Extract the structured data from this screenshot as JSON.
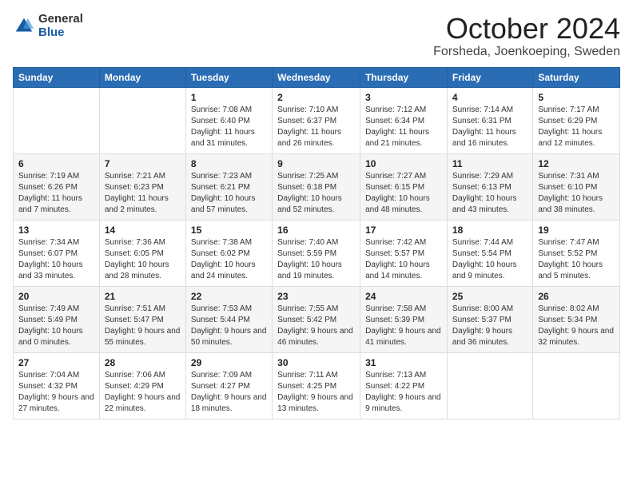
{
  "header": {
    "logo_general": "General",
    "logo_blue": "Blue",
    "title": "October 2024",
    "location": "Forsheda, Joenkoeping, Sweden"
  },
  "days_of_week": [
    "Sunday",
    "Monday",
    "Tuesday",
    "Wednesday",
    "Thursday",
    "Friday",
    "Saturday"
  ],
  "weeks": [
    [
      {
        "num": "",
        "info": ""
      },
      {
        "num": "",
        "info": ""
      },
      {
        "num": "1",
        "info": "Sunrise: 7:08 AM\nSunset: 6:40 PM\nDaylight: 11 hours and 31 minutes."
      },
      {
        "num": "2",
        "info": "Sunrise: 7:10 AM\nSunset: 6:37 PM\nDaylight: 11 hours and 26 minutes."
      },
      {
        "num": "3",
        "info": "Sunrise: 7:12 AM\nSunset: 6:34 PM\nDaylight: 11 hours and 21 minutes."
      },
      {
        "num": "4",
        "info": "Sunrise: 7:14 AM\nSunset: 6:31 PM\nDaylight: 11 hours and 16 minutes."
      },
      {
        "num": "5",
        "info": "Sunrise: 7:17 AM\nSunset: 6:29 PM\nDaylight: 11 hours and 12 minutes."
      }
    ],
    [
      {
        "num": "6",
        "info": "Sunrise: 7:19 AM\nSunset: 6:26 PM\nDaylight: 11 hours and 7 minutes."
      },
      {
        "num": "7",
        "info": "Sunrise: 7:21 AM\nSunset: 6:23 PM\nDaylight: 11 hours and 2 minutes."
      },
      {
        "num": "8",
        "info": "Sunrise: 7:23 AM\nSunset: 6:21 PM\nDaylight: 10 hours and 57 minutes."
      },
      {
        "num": "9",
        "info": "Sunrise: 7:25 AM\nSunset: 6:18 PM\nDaylight: 10 hours and 52 minutes."
      },
      {
        "num": "10",
        "info": "Sunrise: 7:27 AM\nSunset: 6:15 PM\nDaylight: 10 hours and 48 minutes."
      },
      {
        "num": "11",
        "info": "Sunrise: 7:29 AM\nSunset: 6:13 PM\nDaylight: 10 hours and 43 minutes."
      },
      {
        "num": "12",
        "info": "Sunrise: 7:31 AM\nSunset: 6:10 PM\nDaylight: 10 hours and 38 minutes."
      }
    ],
    [
      {
        "num": "13",
        "info": "Sunrise: 7:34 AM\nSunset: 6:07 PM\nDaylight: 10 hours and 33 minutes."
      },
      {
        "num": "14",
        "info": "Sunrise: 7:36 AM\nSunset: 6:05 PM\nDaylight: 10 hours and 28 minutes."
      },
      {
        "num": "15",
        "info": "Sunrise: 7:38 AM\nSunset: 6:02 PM\nDaylight: 10 hours and 24 minutes."
      },
      {
        "num": "16",
        "info": "Sunrise: 7:40 AM\nSunset: 5:59 PM\nDaylight: 10 hours and 19 minutes."
      },
      {
        "num": "17",
        "info": "Sunrise: 7:42 AM\nSunset: 5:57 PM\nDaylight: 10 hours and 14 minutes."
      },
      {
        "num": "18",
        "info": "Sunrise: 7:44 AM\nSunset: 5:54 PM\nDaylight: 10 hours and 9 minutes."
      },
      {
        "num": "19",
        "info": "Sunrise: 7:47 AM\nSunset: 5:52 PM\nDaylight: 10 hours and 5 minutes."
      }
    ],
    [
      {
        "num": "20",
        "info": "Sunrise: 7:49 AM\nSunset: 5:49 PM\nDaylight: 10 hours and 0 minutes."
      },
      {
        "num": "21",
        "info": "Sunrise: 7:51 AM\nSunset: 5:47 PM\nDaylight: 9 hours and 55 minutes."
      },
      {
        "num": "22",
        "info": "Sunrise: 7:53 AM\nSunset: 5:44 PM\nDaylight: 9 hours and 50 minutes."
      },
      {
        "num": "23",
        "info": "Sunrise: 7:55 AM\nSunset: 5:42 PM\nDaylight: 9 hours and 46 minutes."
      },
      {
        "num": "24",
        "info": "Sunrise: 7:58 AM\nSunset: 5:39 PM\nDaylight: 9 hours and 41 minutes."
      },
      {
        "num": "25",
        "info": "Sunrise: 8:00 AM\nSunset: 5:37 PM\nDaylight: 9 hours and 36 minutes."
      },
      {
        "num": "26",
        "info": "Sunrise: 8:02 AM\nSunset: 5:34 PM\nDaylight: 9 hours and 32 minutes."
      }
    ],
    [
      {
        "num": "27",
        "info": "Sunrise: 7:04 AM\nSunset: 4:32 PM\nDaylight: 9 hours and 27 minutes."
      },
      {
        "num": "28",
        "info": "Sunrise: 7:06 AM\nSunset: 4:29 PM\nDaylight: 9 hours and 22 minutes."
      },
      {
        "num": "29",
        "info": "Sunrise: 7:09 AM\nSunset: 4:27 PM\nDaylight: 9 hours and 18 minutes."
      },
      {
        "num": "30",
        "info": "Sunrise: 7:11 AM\nSunset: 4:25 PM\nDaylight: 9 hours and 13 minutes."
      },
      {
        "num": "31",
        "info": "Sunrise: 7:13 AM\nSunset: 4:22 PM\nDaylight: 9 hours and 9 minutes."
      },
      {
        "num": "",
        "info": ""
      },
      {
        "num": "",
        "info": ""
      }
    ]
  ]
}
